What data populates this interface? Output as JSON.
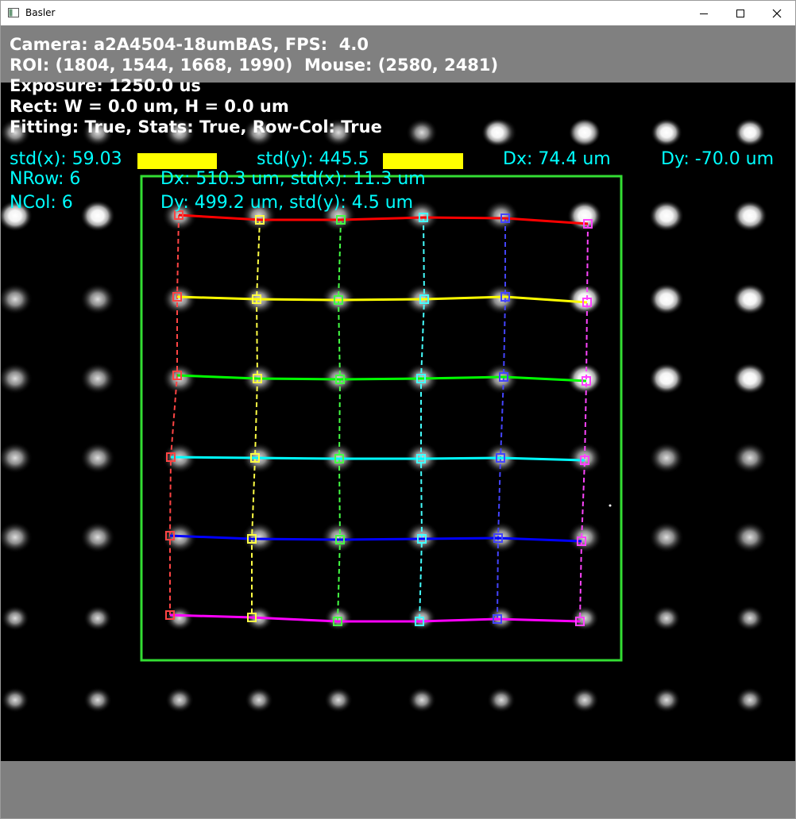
{
  "window": {
    "title": "Basler",
    "icon": "window-app-icon",
    "controls": [
      "minimize-icon",
      "maximize-icon",
      "close-icon"
    ]
  },
  "overlay": {
    "camera_line": "Camera: a2A4504-18umBAS, FPS:  4.0",
    "roi_line": "ROI: (1804, 1544, 1668, 1990)  Mouse: (2580, 2481)",
    "exposure_line": "Exposure: 1250.0 us",
    "rect_line": "Rect: W = 0.0 um, H = 0.0 um",
    "fitting_line": "Fitting: True, Stats: True, Row-Col: True"
  },
  "stats": {
    "std_x": "std(x): 59.03",
    "std_y": "std(y): 445.5",
    "dx_total": "Dx: 74.4 um",
    "dy_total": "Dy: -70.0 um",
    "nrow": "NRow: 6",
    "ncol": "NCol: 6",
    "dx_line": "Dx: 510.3 um, std(x): 11.3 um",
    "dy_line": "Dy: 499.2 um, std(y): 4.5 um"
  },
  "colors": {
    "header_gray": "#808080",
    "text_white": "#ffffff",
    "text_cyan": "#00ffff",
    "stat_bar_yellow": "#ffff00",
    "roi_green": "#33dd33",
    "row_colors": [
      "#ff0000",
      "#ffff00",
      "#00ff00",
      "#00ffff",
      "#0000ff",
      "#ff00ff"
    ],
    "col_colors": [
      "#ff4444",
      "#ffff44",
      "#44ff44",
      "#44ffff",
      "#4444ff",
      "#ff44ff"
    ]
  }
}
